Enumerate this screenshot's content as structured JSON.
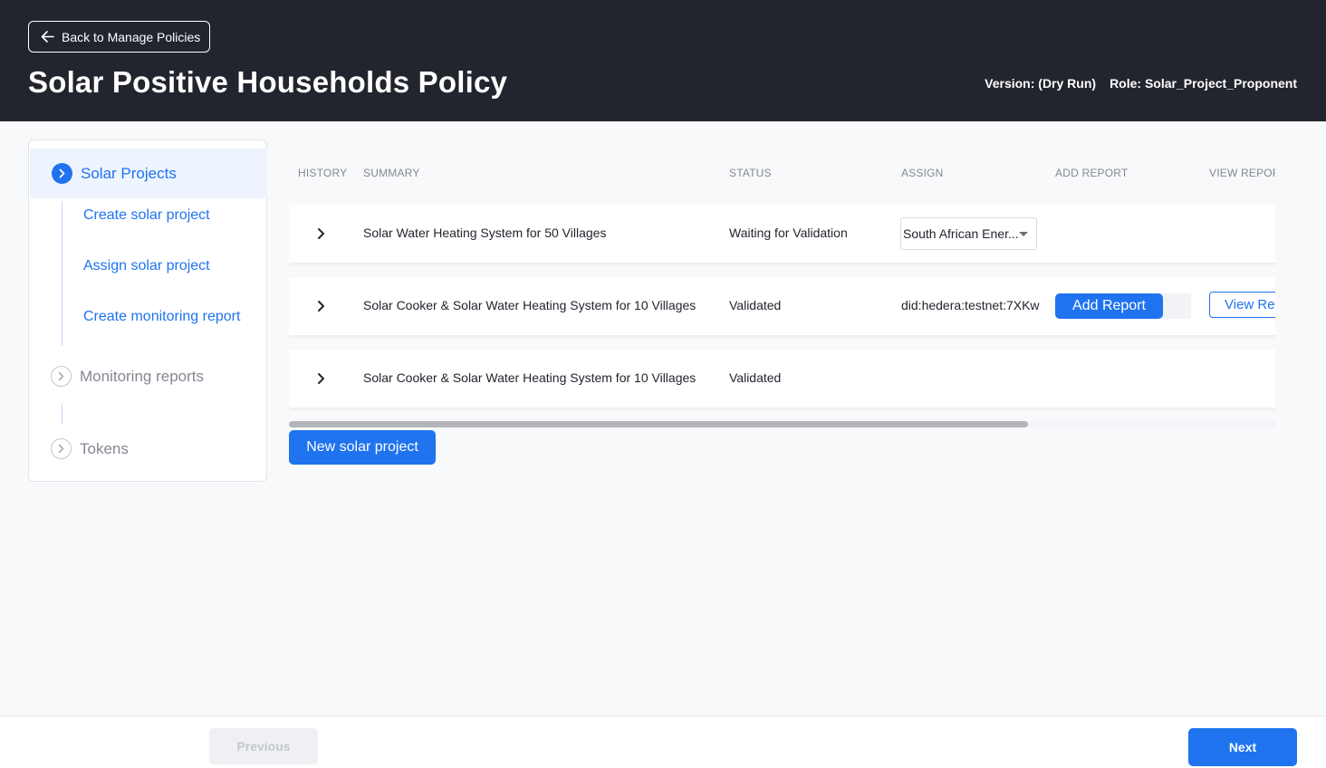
{
  "header": {
    "back_label": "Back to Manage Policies",
    "title": "Solar Positive Households Policy",
    "version": "Version: (Dry Run)",
    "role": "Role: Solar_Project_Proponent"
  },
  "sidebar": {
    "active": "Solar Projects",
    "sub_items": [
      "Create solar project",
      "Assign solar project",
      "Create monitoring report"
    ],
    "monitoring": "Monitoring reports",
    "tokens": "Tokens"
  },
  "table": {
    "headers": [
      "HISTORY",
      "SUMMARY",
      "STATUS",
      "ASSIGN",
      "ADD REPORT",
      "VIEW REPOR"
    ],
    "rows": [
      {
        "summary": "Solar Water Heating System for 50 Villages",
        "status": "Waiting for Validation",
        "assign": "South African Ener..."
      },
      {
        "summary": "Solar Cooker & Solar Water Heating System for 10 Villages",
        "status": "Validated",
        "assign": "did:hedera:testnet:7XKw",
        "add_report": "Add Report",
        "view_report": "View Rep"
      },
      {
        "summary": "Solar Cooker & Solar Water Heating System for 10 Villages",
        "status": "Validated"
      }
    ]
  },
  "new_project_label": "New solar project",
  "footer": {
    "previous": "Previous",
    "next": "Next"
  },
  "colors": {
    "header_bg": "#23252e",
    "accent": "#1f73ef"
  }
}
